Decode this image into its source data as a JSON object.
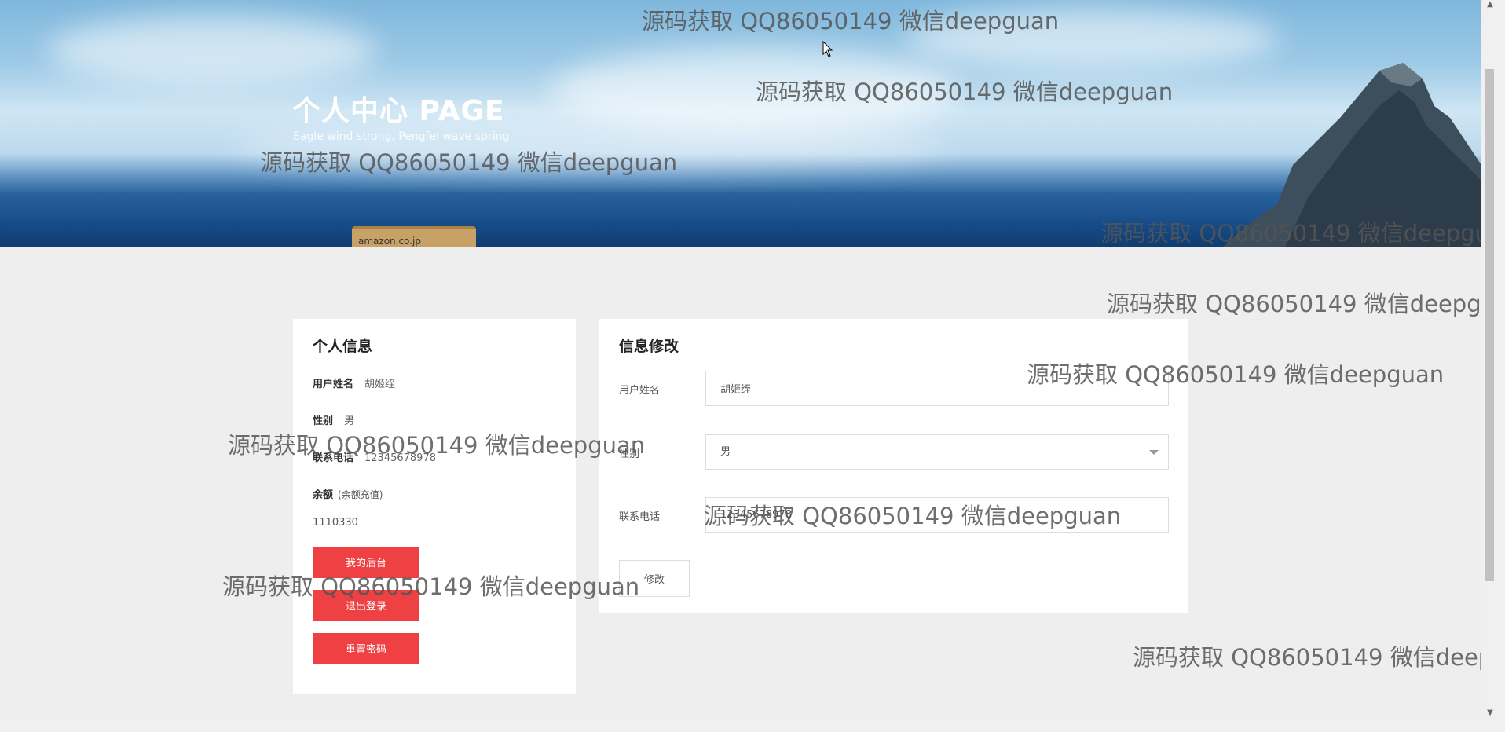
{
  "banner": {
    "title": "个人中心 PAGE",
    "subtitle": "Eagle wind strong, Pengfei wave spring",
    "box_label": "amazon.co.jp"
  },
  "profile": {
    "heading": "个人信息",
    "name_label": "用户姓名",
    "name_value": "胡姬绖",
    "gender_label": "性别",
    "gender_value": "男",
    "phone_label": "联系电话",
    "phone_value": "12345678978",
    "balance_label": "余额",
    "recharge_link": "(余额充值)",
    "balance_value": "1110330",
    "btn_backend": "我的后台",
    "btn_logout": "退出登录",
    "btn_reset": "重置密码"
  },
  "edit_form": {
    "heading": "信息修改",
    "name_label": "用户姓名",
    "name_value": "胡姬绖",
    "gender_label": "性别",
    "gender_value": "男",
    "phone_label": "联系电话",
    "phone_value": "12345678978",
    "submit_label": "修改"
  },
  "watermark": "源码获取 QQ86050149 微信deepguan",
  "colors": {
    "accent_red": "#ef4044",
    "page_bg": "#eeeeee"
  }
}
